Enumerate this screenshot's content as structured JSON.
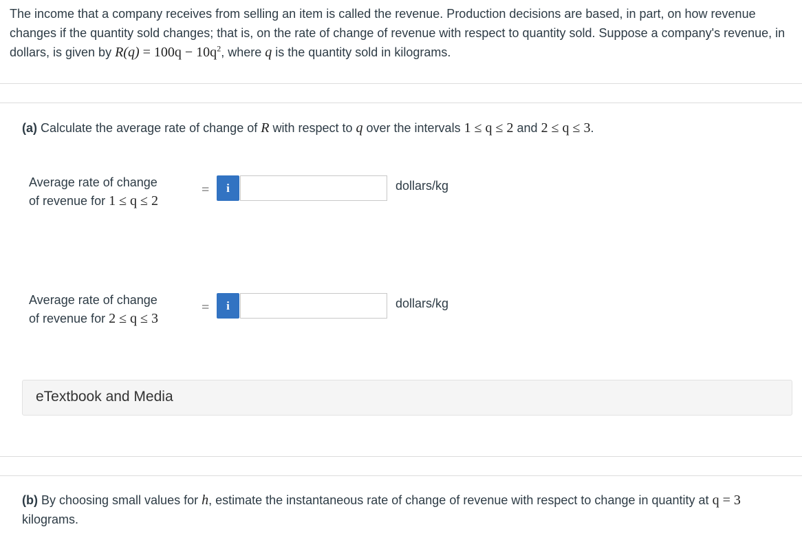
{
  "intro": {
    "text_1": "The income that a company receives from selling an item is called the revenue. Production decisions are based, in part, on how revenue changes if the quantity sold changes; that is, on the rate of change of revenue with respect to quantity sold. Suppose a company's revenue, in dollars, is given by ",
    "formula_lhs": "R(q)",
    "formula_rhs_a": "= 100q − 10q",
    "formula_exp": "2",
    "text_2": ", where ",
    "var_q": "q",
    "text_3": " is the quantity sold in kilograms."
  },
  "part_a": {
    "tag": "(a)",
    "text_1": " Calculate the average rate of change of ",
    "var_R": "R",
    "text_2": " with respect to ",
    "var_q": "q",
    "text_3": " over the intervals ",
    "interval_1": "1 ≤ q ≤ 2",
    "text_and": " and ",
    "interval_2": "2 ≤ q ≤ 3",
    "text_end": "."
  },
  "rows": [
    {
      "label_line1": "Average rate of change",
      "label_line2": "of revenue for ",
      "interval": "1 ≤ q ≤ 2",
      "equals": "=",
      "info_label": "i",
      "value": "",
      "placeholder": "",
      "unit": "dollars/kg"
    },
    {
      "label_line1": "Average rate of change",
      "label_line2": "of revenue for ",
      "interval": "2 ≤ q ≤ 3",
      "equals": "=",
      "info_label": "i",
      "value": "",
      "placeholder": "",
      "unit": "dollars/kg"
    }
  ],
  "etextbook": {
    "label": "eTextbook and Media"
  },
  "part_b": {
    "tag": "(b)",
    "text_1": " By choosing small values for ",
    "var_h": "h",
    "text_2": ", estimate the instantaneous rate of change of revenue with respect to change in quantity at ",
    "condition": "q = 3",
    "text_3": " kilograms."
  },
  "colors": {
    "info_button": "#3273c2",
    "panel_bg": "#f5f5f5",
    "text": "#2d3b45"
  }
}
